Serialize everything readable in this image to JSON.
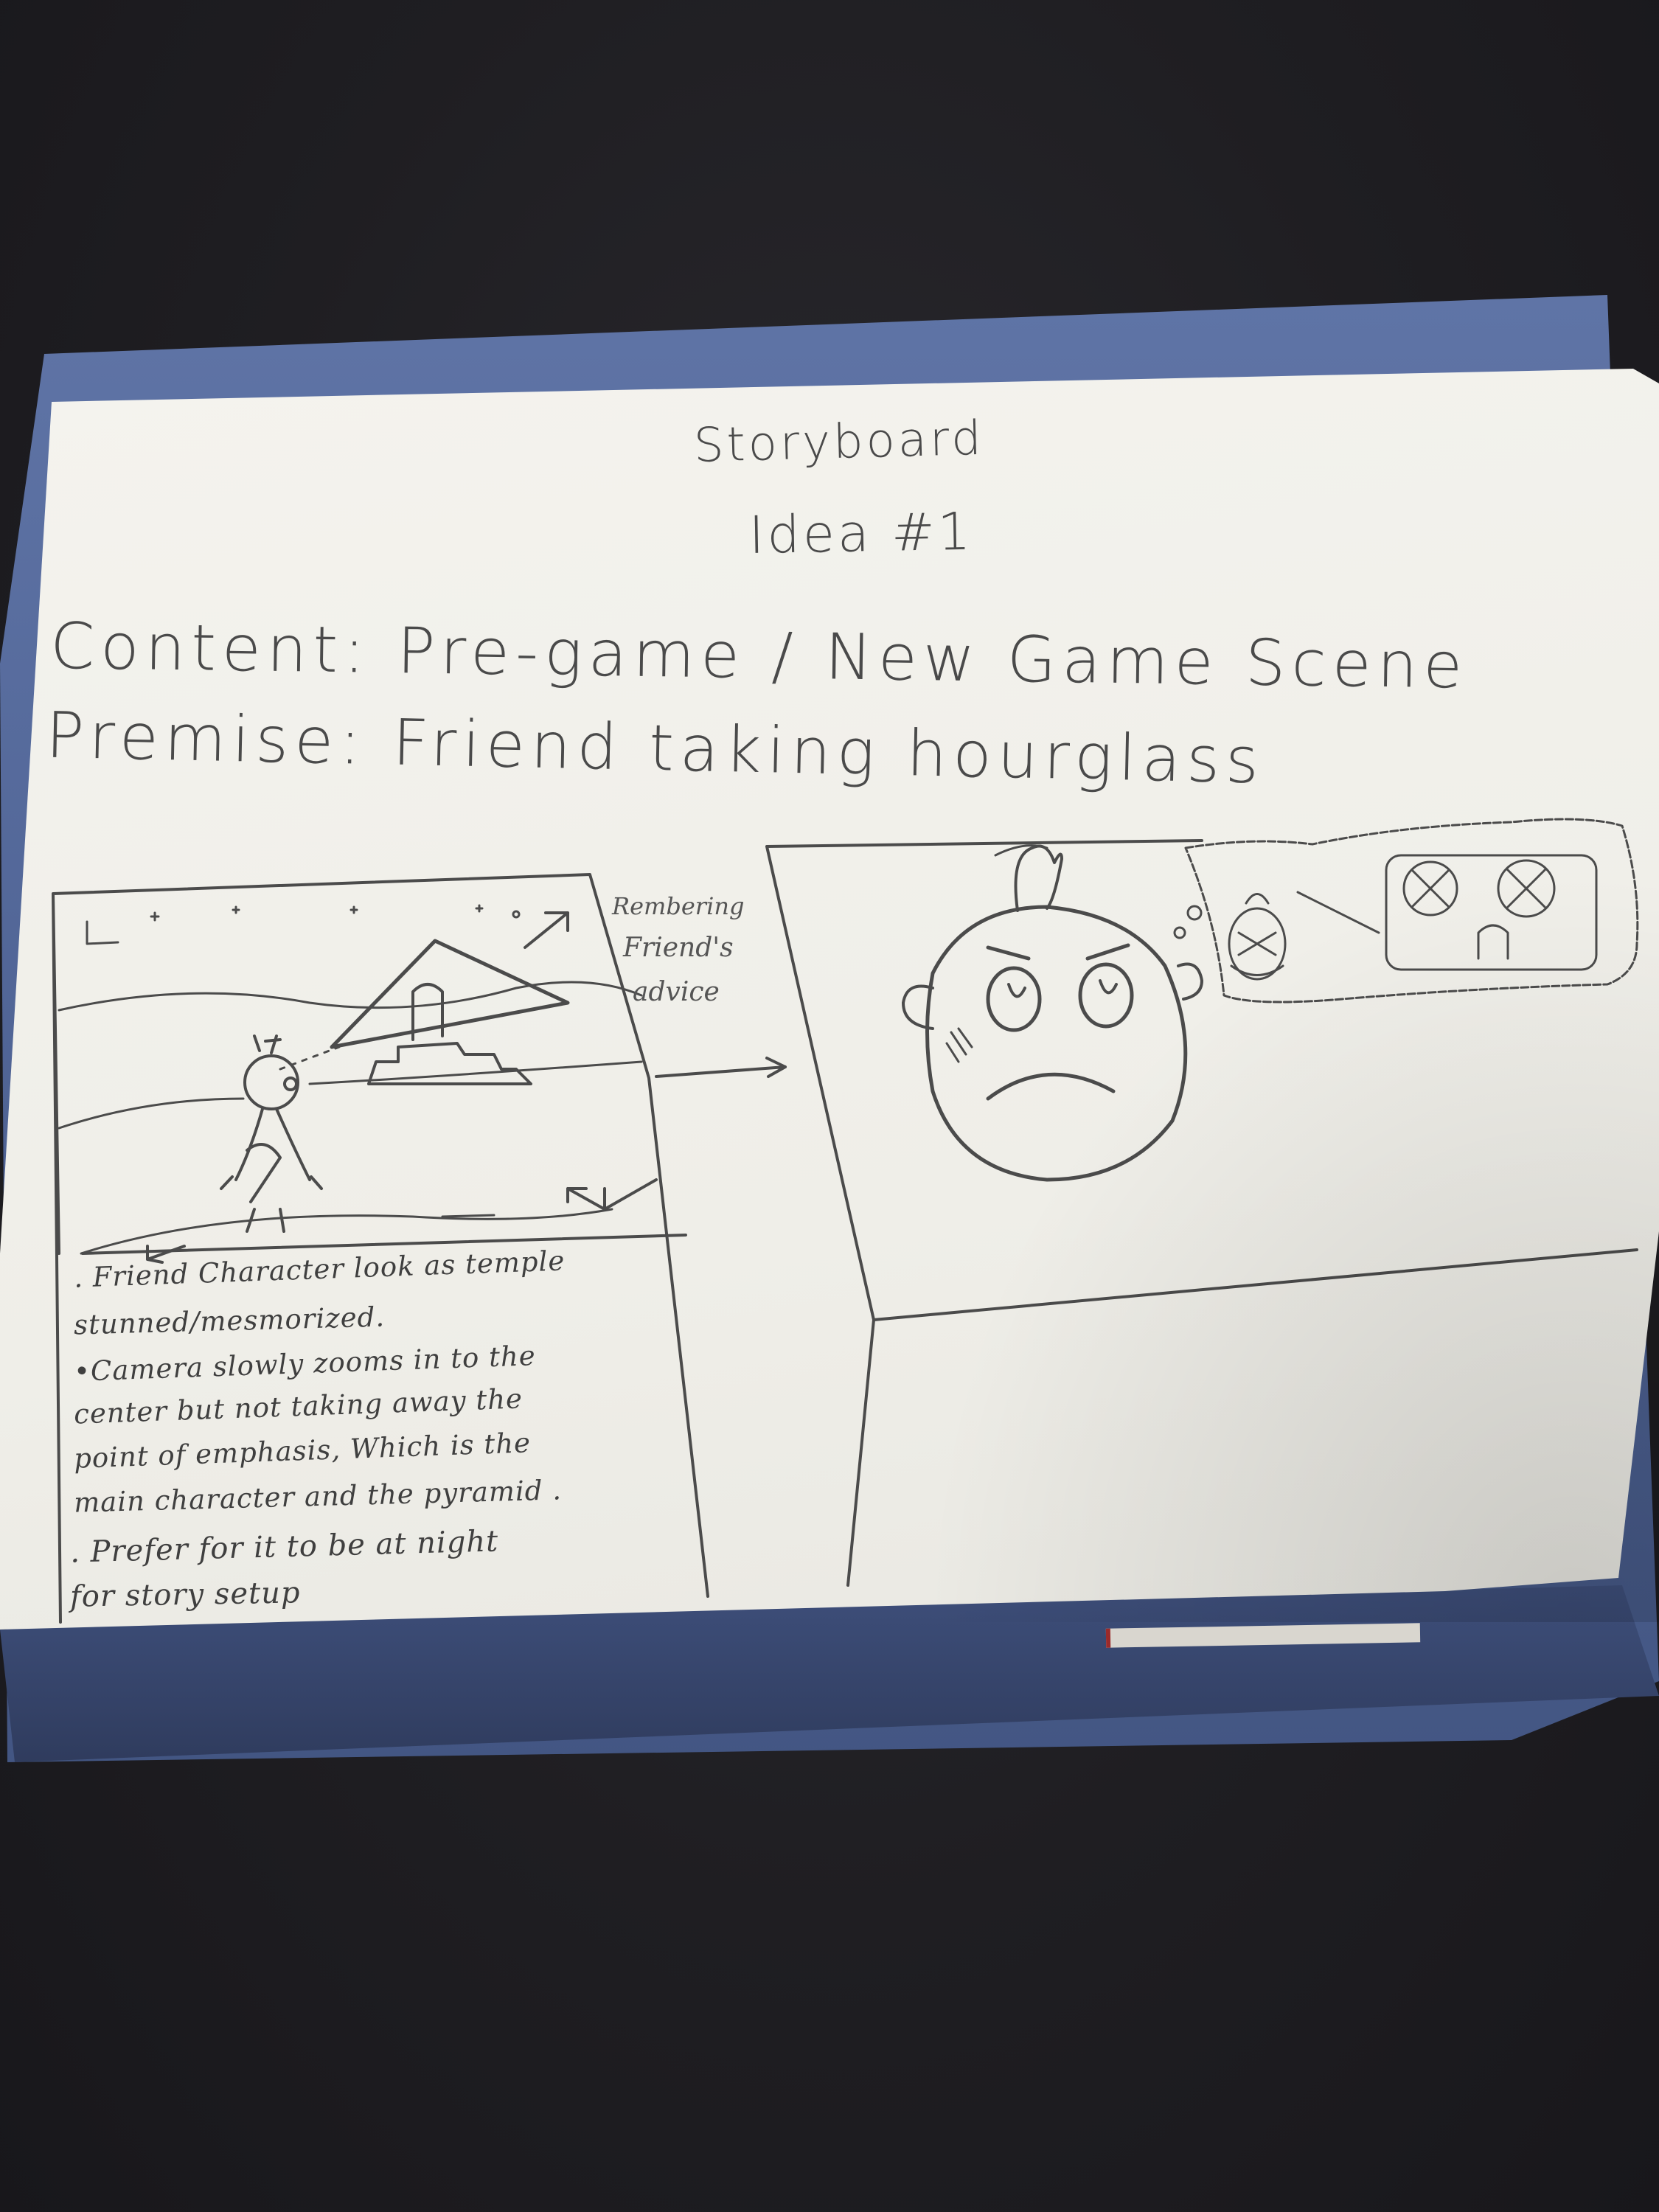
{
  "storyboard": {
    "heading": "Storyboard",
    "subheading": "Idea #1",
    "content_line": "Content: Pre-game / New Game Scene",
    "premise_line": "Premise: Friend  taking  hourglass"
  },
  "panel1": {
    "notes": [
      ". Friend Character  look as  temple",
      "stunned/mesmorized.",
      "•Camera  slowly zooms  in  to the",
      "center  but not  taking away  the",
      "point  of  emphasis,  Which is the",
      "main character  and  the pyramid .",
      ". Prefer  for it  to be  at  night",
      "for  story  setup"
    ]
  },
  "transition": {
    "lines": [
      "Rembering",
      "Friend's",
      "advice"
    ]
  }
}
